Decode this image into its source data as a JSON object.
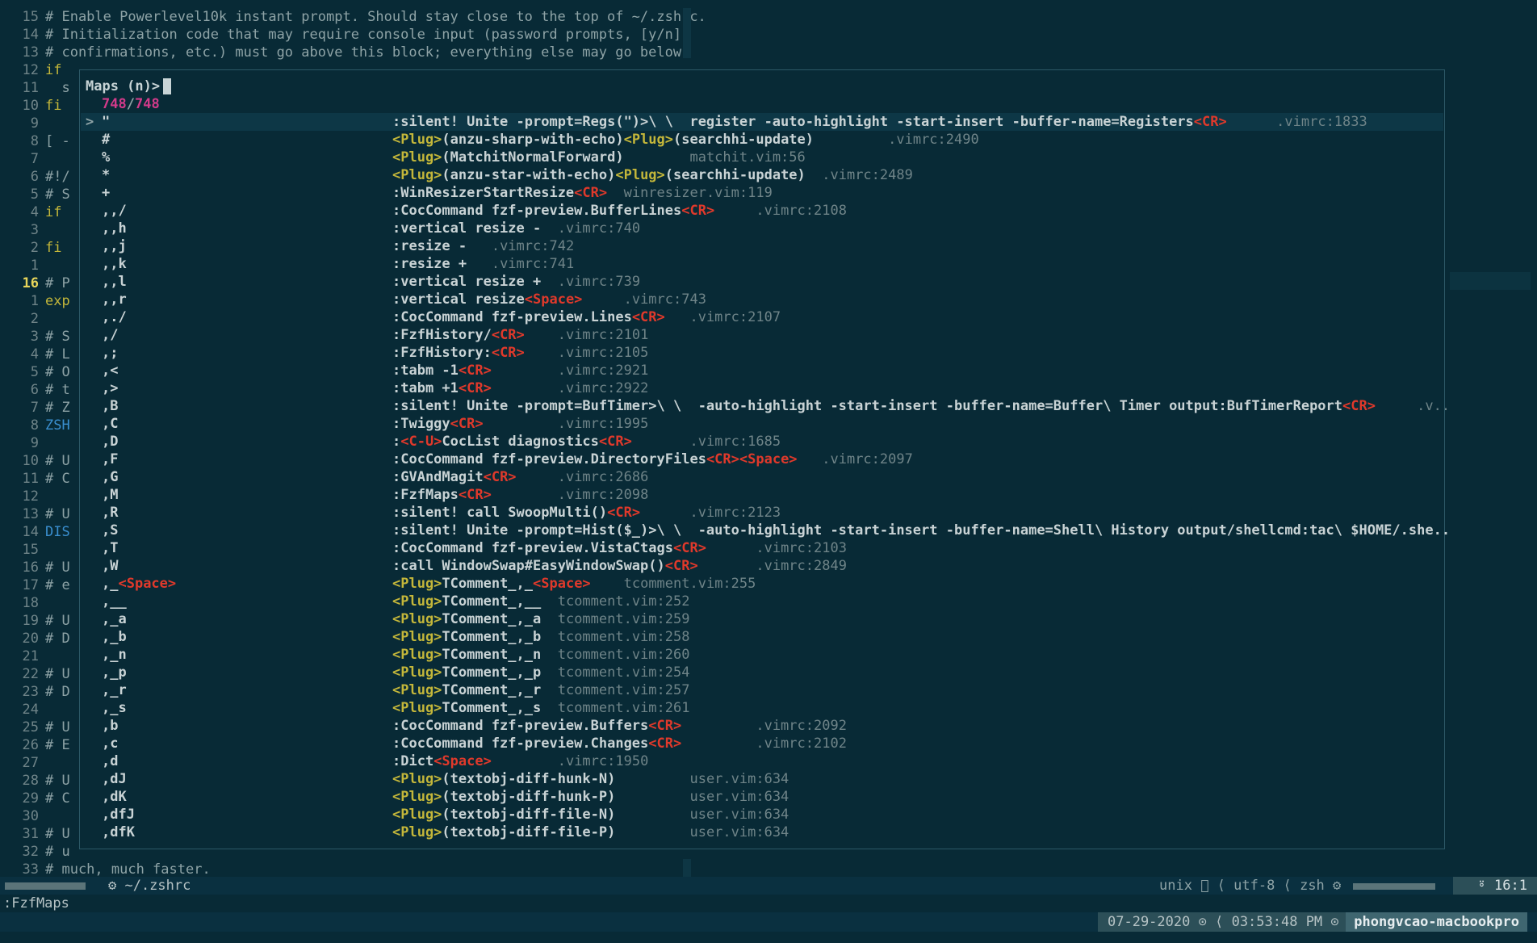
{
  "editor": {
    "top_lines": [
      {
        "num": "15",
        "text": "# Enable Powerlevel10k instant prompt. Should stay close to the top of ~/.zshrc."
      },
      {
        "num": "14",
        "text": "# Initialization code that may require console input (password prompts, [y/n]"
      },
      {
        "num": "13",
        "text": "# confirmations, etc.) must go above this block; everything else may go below."
      }
    ],
    "gutter": [
      {
        "num": "12",
        "text": "if"
      },
      {
        "num": "11",
        "text": "  s"
      },
      {
        "num": "10",
        "text": "fi"
      },
      {
        "num": "9",
        "text": ""
      },
      {
        "num": "8",
        "text": "[ -"
      },
      {
        "num": "7",
        "text": ""
      },
      {
        "num": "6",
        "text": "#!/"
      },
      {
        "num": "5",
        "text": "# S"
      },
      {
        "num": "4",
        "text": "if"
      },
      {
        "num": "3",
        "text": ""
      },
      {
        "num": "2",
        "text": "fi"
      },
      {
        "num": "1",
        "text": ""
      },
      {
        "num": "16",
        "text": "# P"
      },
      {
        "num": "1",
        "text": "exp"
      },
      {
        "num": "2",
        "text": ""
      },
      {
        "num": "3",
        "text": "# S"
      },
      {
        "num": "4",
        "text": "# L"
      },
      {
        "num": "5",
        "text": "# O"
      },
      {
        "num": "6",
        "text": "# t"
      },
      {
        "num": "7",
        "text": "# Z"
      },
      {
        "num": "8",
        "text": "ZSH"
      },
      {
        "num": "9",
        "text": ""
      },
      {
        "num": "10",
        "text": "# U"
      },
      {
        "num": "11",
        "text": "# C"
      },
      {
        "num": "12",
        "text": ""
      },
      {
        "num": "13",
        "text": "# U"
      },
      {
        "num": "14",
        "text": "DIS"
      },
      {
        "num": "15",
        "text": ""
      },
      {
        "num": "16",
        "text": "# U"
      },
      {
        "num": "17",
        "text": "# e"
      },
      {
        "num": "18",
        "text": ""
      },
      {
        "num": "19",
        "text": "# U"
      },
      {
        "num": "20",
        "text": "# D"
      },
      {
        "num": "21",
        "text": ""
      },
      {
        "num": "22",
        "text": "# U"
      },
      {
        "num": "23",
        "text": "# D"
      },
      {
        "num": "24",
        "text": ""
      },
      {
        "num": "25",
        "text": "# U"
      },
      {
        "num": "26",
        "text": "# E"
      },
      {
        "num": "27",
        "text": ""
      },
      {
        "num": "28",
        "text": "# U"
      },
      {
        "num": "29",
        "text": "# C"
      },
      {
        "num": "30",
        "text": ""
      },
      {
        "num": "31",
        "text": "# U"
      },
      {
        "num": "32",
        "text": "# u"
      },
      {
        "num": "33",
        "text": "# much, much faster."
      }
    ]
  },
  "popup": {
    "prompt": "Maps (n)>",
    "count_current": "748",
    "count_total": "748",
    "selector": ">",
    "entries": [
      {
        "key": "\"",
        "cmd": ":silent! Unite -prompt=Regs(\")>\\ \\  register -auto-highlight -start-insert -buffer-name=Registers<CR>",
        "loc": "      .vimrc:1833"
      },
      {
        "key": "#",
        "cmd": "<Plug>(anzu-sharp-with-echo)<Plug>(searchhi-update)",
        "loc": "         .vimrc:2490"
      },
      {
        "key": "%",
        "cmd": "<Plug>(MatchitNormalForward)",
        "loc": "        matchit.vim:56"
      },
      {
        "key": "*",
        "cmd": "<Plug>(anzu-star-with-echo)<Plug>(searchhi-update)",
        "loc": "  .vimrc:2489"
      },
      {
        "key": "+",
        "cmd": ":WinResizerStartResize<CR>",
        "loc": "  winresizer.vim:119"
      },
      {
        "key": ",,/",
        "cmd": ":CocCommand fzf-preview.BufferLines<CR>",
        "loc": "     .vimrc:2108"
      },
      {
        "key": ",,h",
        "cmd": ":vertical resize -",
        "loc": "  .vimrc:740"
      },
      {
        "key": ",,j",
        "cmd": ":resize -",
        "loc": "   .vimrc:742"
      },
      {
        "key": ",,k",
        "cmd": ":resize +",
        "loc": "   .vimrc:741"
      },
      {
        "key": ",,l",
        "cmd": ":vertical resize +",
        "loc": "  .vimrc:739"
      },
      {
        "key": ",,r",
        "cmd": ":vertical resize<Space>",
        "loc": "     .vimrc:743"
      },
      {
        "key": ",./",
        "cmd": ":CocCommand fzf-preview.Lines<CR>",
        "loc": "   .vimrc:2107"
      },
      {
        "key": ",/",
        "cmd": ":FzfHistory/<CR>",
        "loc": "    .vimrc:2101"
      },
      {
        "key": ",;",
        "cmd": ":FzfHistory:<CR>",
        "loc": "    .vimrc:2105"
      },
      {
        "key": ",<",
        "cmd": ":tabm -1<CR>",
        "loc": "        .vimrc:2921"
      },
      {
        "key": ",>",
        "cmd": ":tabm +1<CR>",
        "loc": "        .vimrc:2922"
      },
      {
        "key": ",B",
        "cmd": ":silent! Unite -prompt=BufTimer>\\ \\  -auto-highlight -start-insert -buffer-name=Buffer\\ Timer output:BufTimerReport<CR>",
        "loc": "     .v.."
      },
      {
        "key": ",C",
        "cmd": ":Twiggy<CR>",
        "loc": "         .vimrc:1995"
      },
      {
        "key": ",D",
        "cmd": ":<C-U>CocList diagnostics<CR>",
        "loc": "       .vimrc:1685"
      },
      {
        "key": ",F",
        "cmd": ":CocCommand fzf-preview.DirectoryFiles<CR><Space>",
        "loc": "   .vimrc:2097"
      },
      {
        "key": ",G",
        "cmd": ":GVAndMagit<CR>",
        "loc": "     .vimrc:2686"
      },
      {
        "key": ",M",
        "cmd": ":FzfMaps<CR>",
        "loc": "        .vimrc:2098"
      },
      {
        "key": ",R",
        "cmd": ":silent! call SwoopMulti()<CR>",
        "loc": "      .vimrc:2123"
      },
      {
        "key": ",S",
        "cmd": ":silent! Unite -prompt=Hist($_)>\\ \\  -auto-highlight -start-insert -buffer-name=Shell\\ History output/shellcmd:tac\\ $HOME/.she..",
        "loc": ""
      },
      {
        "key": ",T",
        "cmd": ":CocCommand fzf-preview.VistaCtags<CR>",
        "loc": "      .vimrc:2103"
      },
      {
        "key": ",W",
        "cmd": ":call WindowSwap#EasyWindowSwap()<CR>",
        "loc": "       .vimrc:2849"
      },
      {
        "key": ",_<Space>",
        "cmd": "<Plug>TComment_,_<Space>",
        "loc": "    tcomment.vim:255"
      },
      {
        "key": ",__",
        "cmd": "<Plug>TComment_,__",
        "loc": "  tcomment.vim:252"
      },
      {
        "key": ",_a",
        "cmd": "<Plug>TComment_,_a",
        "loc": "  tcomment.vim:259"
      },
      {
        "key": ",_b",
        "cmd": "<Plug>TComment_,_b",
        "loc": "  tcomment.vim:258"
      },
      {
        "key": ",_n",
        "cmd": "<Plug>TComment_,_n",
        "loc": "  tcomment.vim:260"
      },
      {
        "key": ",_p",
        "cmd": "<Plug>TComment_,_p",
        "loc": "  tcomment.vim:254"
      },
      {
        "key": ",_r",
        "cmd": "<Plug>TComment_,_r",
        "loc": "  tcomment.vim:257"
      },
      {
        "key": ",_s",
        "cmd": "<Plug>TComment_,_s",
        "loc": "  tcomment.vim:261"
      },
      {
        "key": ",b",
        "cmd": ":CocCommand fzf-preview.Buffers<CR>",
        "loc": "         .vimrc:2092"
      },
      {
        "key": ",c",
        "cmd": ":CocCommand fzf-preview.Changes<CR>",
        "loc": "         .vimrc:2102"
      },
      {
        "key": ",d",
        "cmd": ":Dict<Space>",
        "loc": "        .vimrc:1950"
      },
      {
        "key": ",dJ",
        "cmd": "<Plug>(textobj-diff-hunk-N)",
        "loc": "         user.vim:634"
      },
      {
        "key": ",dK",
        "cmd": "<Plug>(textobj-diff-hunk-P)",
        "loc": "         user.vim:634"
      },
      {
        "key": ",dfJ",
        "cmd": "<Plug>(textobj-diff-file-N)",
        "loc": "         user.vim:634"
      },
      {
        "key": ",dfK",
        "cmd": "<Plug>(textobj-diff-file-P)",
        "loc": "         user.vim:634"
      }
    ]
  },
  "statusline": {
    "file": "⚙ ~/.zshrc",
    "format": "unix",
    "encoding": "utf-8",
    "filetype": "zsh",
    "position": "16:1"
  },
  "cmdline": ":FzfMaps",
  "tmux": {
    "date": "07-29-2020",
    "time": "03:53:48 PM",
    "host": "phongvcao-macbookpro"
  }
}
